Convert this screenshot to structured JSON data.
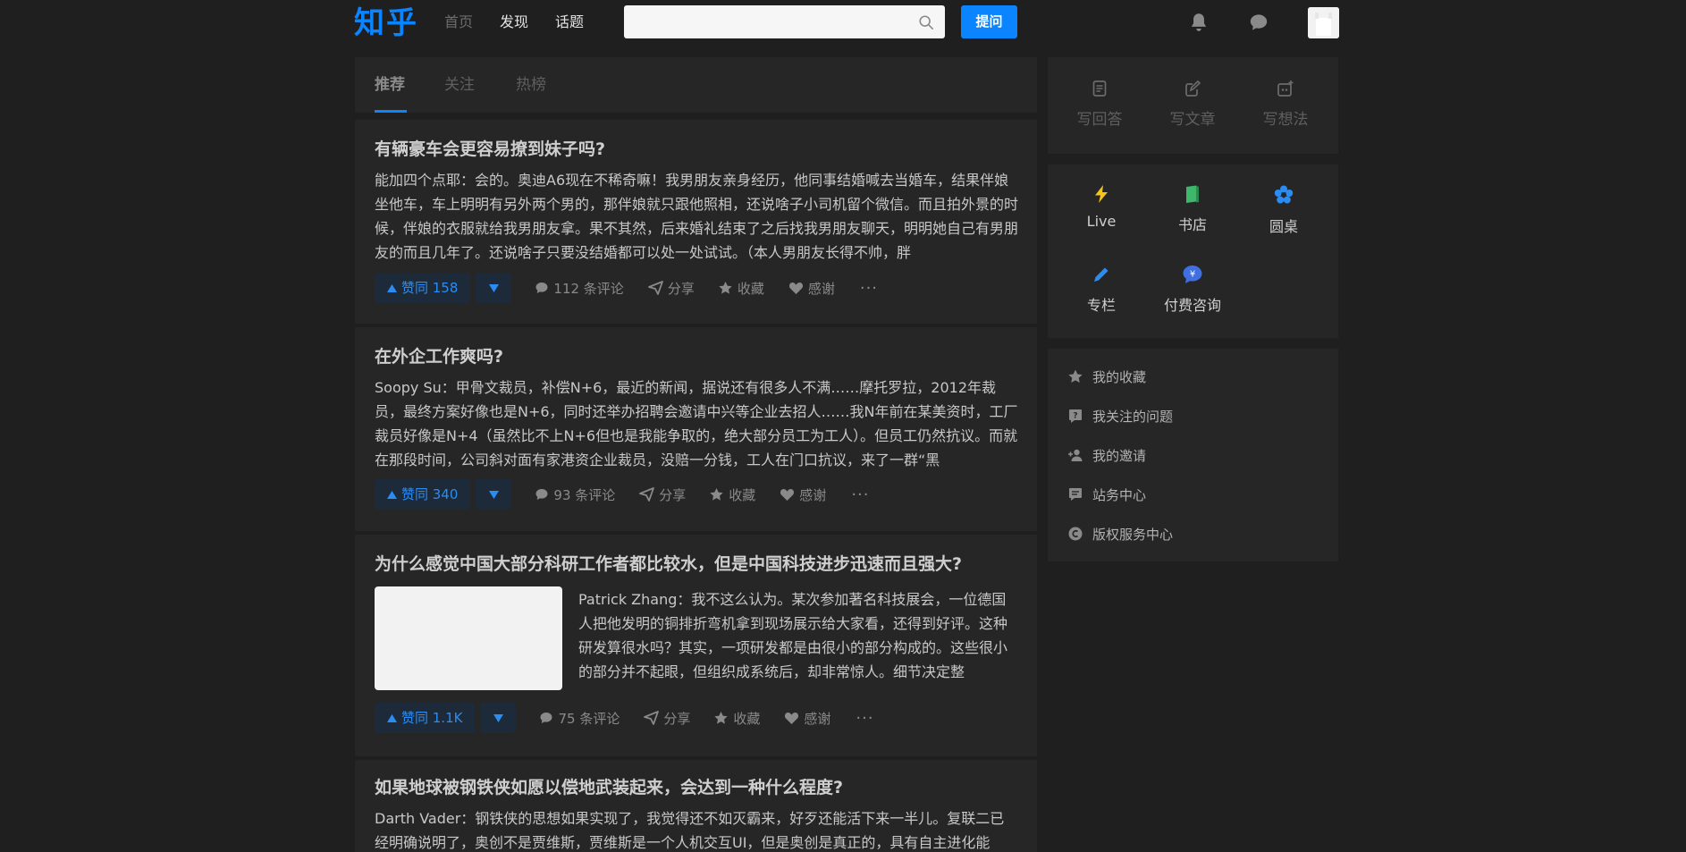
{
  "header": {
    "logo": "知乎",
    "nav": [
      "首页",
      "发现",
      "话题"
    ],
    "search_placeholder": "",
    "ask_label": "提问"
  },
  "feed": {
    "tabs": [
      "推荐",
      "关注",
      "热榜"
    ],
    "cards": [
      {
        "title": "有辆豪车会更容易撩到妹子吗?",
        "excerpt": "能加四个点耶：会的。奥迪A6现在不稀奇嘛！我男朋友亲身经历，他同事结婚喊去当婚车，结果伴娘坐他车，车上明明有另外两个男的，那伴娘就只跟他照相，还说啥子小司机留个微信。而且拍外景的时候，伴娘的衣服就给我男朋友拿。果不其然，后来婚礼结束了之后找我男朋友聊天，明明她自己有男朋友的而且几年了。还说啥子只要没结婚都可以处一处试试。（本人男朋友长得不帅，胖",
        "vote_label": "赞同 158",
        "comments": "112 条评论",
        "share": "分享",
        "collect": "收藏",
        "thanks": "感谢",
        "more": "···"
      },
      {
        "title": "在外企工作爽吗?",
        "excerpt": "Soopy Su：甲骨文裁员，补偿N+6，最近的新闻，据说还有很多人不满……摩托罗拉，2012年裁员，最终方案好像也是N+6，同时还举办招聘会邀请中兴等企业去招人……我N年前在某美资时，工厂裁员好像是N+4（虽然比不上N+6但也是我能争取的，绝大部分员工为工人）。但员工仍然抗议。而就在那段时间，公司斜对面有家港资企业裁员，没赔一分钱，工人在门口抗议，来了一群“黑",
        "vote_label": "赞同 340",
        "comments": "93 条评论",
        "share": "分享",
        "collect": "收藏",
        "thanks": "感谢",
        "more": "···"
      },
      {
        "title": "为什么感觉中国大部分科研工作者都比较水，但是中国科技进步迅速而且强大?",
        "excerpt": "Patrick Zhang：我不这么认为。某次参加著名科技展会，一位德国人把他发明的铜排折弯机拿到现场展示给大家看，还得到好评。这种研发算很水吗？其实，一项研发都是由很小的部分构成的。这些很小的部分并不起眼，但组织成系统后，却非常惊人。细节决定整",
        "vote_label": "赞同 1.1K",
        "comments": "75 条评论",
        "share": "分享",
        "collect": "收藏",
        "thanks": "感谢",
        "more": "···"
      },
      {
        "title": "如果地球被钢铁侠如愿以偿地武装起来，会达到一种什么程度?",
        "excerpt": "Darth Vader：钢铁侠的思想如果实现了，我觉得还不如灭霸来，好歹还能活下来一半儿。复联二已经明确说明了，奥创不是贾维斯，贾维斯是一个人机交互UI，但是奥创是真正的，具有自主进化能"
      }
    ]
  },
  "sidebar": {
    "write": [
      "写回答",
      "写文章",
      "写想法"
    ],
    "features": [
      "Live",
      "书店",
      "圆桌",
      "专栏",
      "付费咨询"
    ],
    "links": [
      "我的收藏",
      "我关注的问题",
      "我的邀请",
      "站务中心",
      "版权服务中心"
    ],
    "colors": {
      "accent": "#0b84ff",
      "live": "#f5c518",
      "book": "#3db86b"
    }
  }
}
